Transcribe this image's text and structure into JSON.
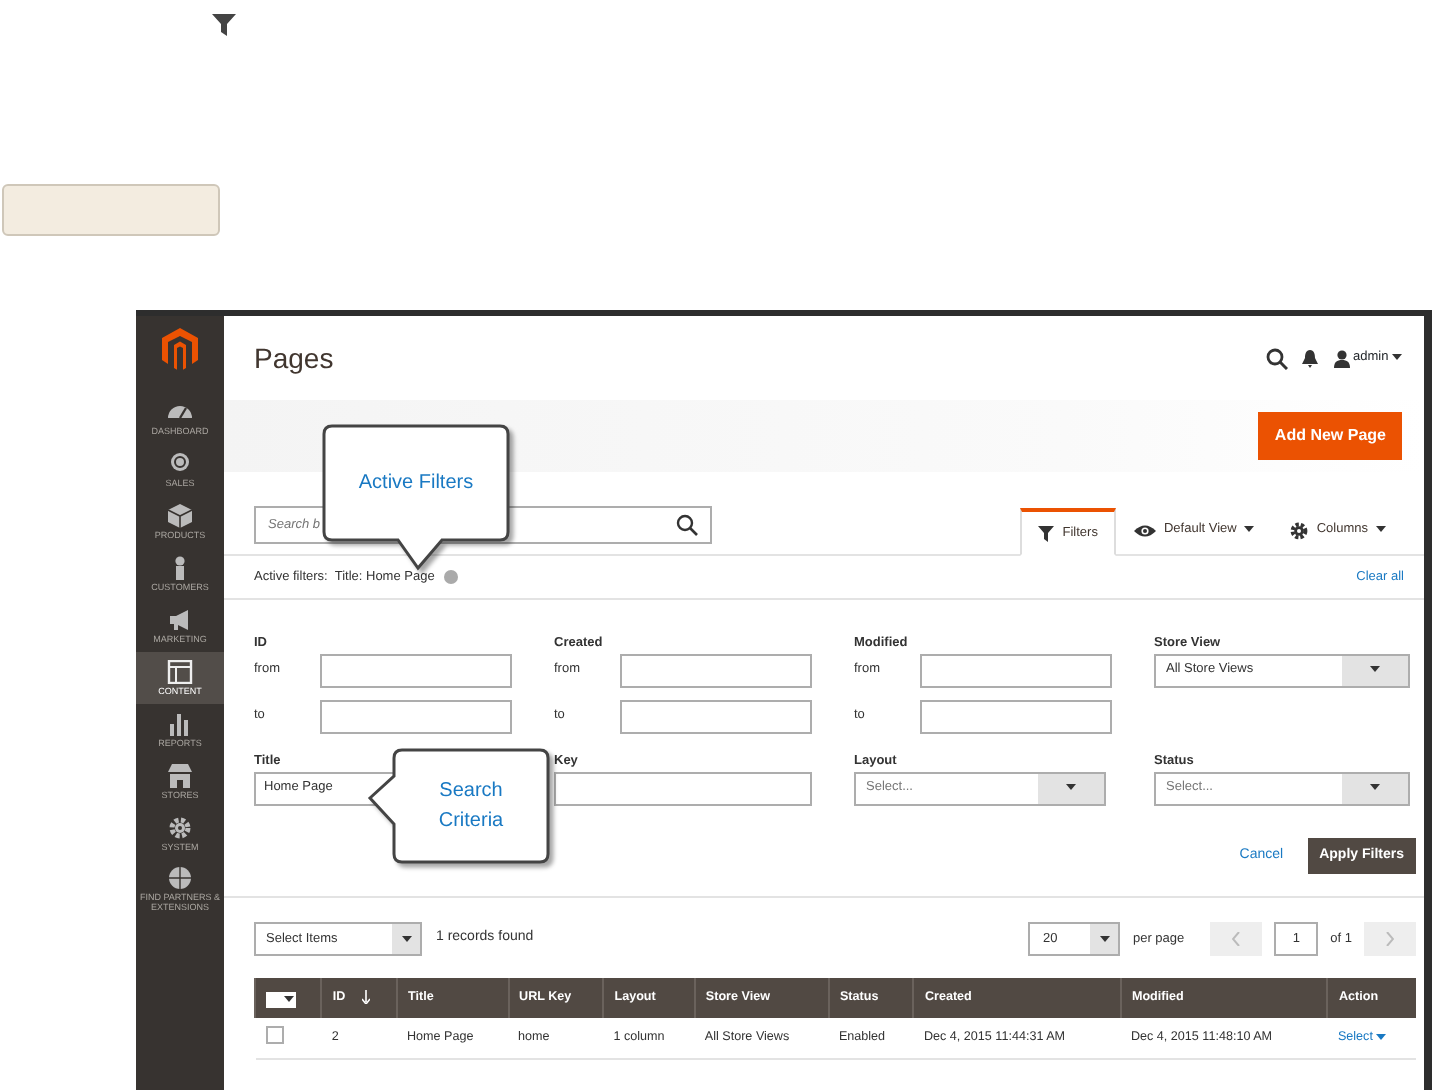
{
  "sidebar": {
    "items": [
      {
        "label": "DASHBOARD",
        "selected": false
      },
      {
        "label": "SALES",
        "selected": false
      },
      {
        "label": "PRODUCTS",
        "selected": false
      },
      {
        "label": "CUSTOMERS",
        "selected": false
      },
      {
        "label": "MARKETING",
        "selected": false
      },
      {
        "label": "CONTENT",
        "selected": true
      },
      {
        "label": "REPORTS",
        "selected": false
      },
      {
        "label": "STORES",
        "selected": false
      },
      {
        "label": "SYSTEM",
        "selected": false
      },
      {
        "label": "FIND PARTNERS & EXTENSIONS",
        "selected": false
      }
    ]
  },
  "header": {
    "title": "Pages",
    "user": "admin"
  },
  "add_button": "Add New Page",
  "search": {
    "placeholder": "Search b"
  },
  "view_tabs": [
    {
      "kind": "filter",
      "label": "Filters",
      "selected": true
    },
    {
      "kind": "view",
      "label": "Default View",
      "selected": false
    },
    {
      "kind": "columns",
      "label": "Columns",
      "selected": false
    }
  ],
  "active_filters": {
    "label": "Active filters:",
    "chips": [
      "Title: Home Page"
    ],
    "clear": "Clear all"
  },
  "filters": [
    {
      "kind": "range",
      "label": "ID",
      "from_label": "from",
      "to_label": "to"
    },
    {
      "kind": "range",
      "label": "Created",
      "from_label": "from",
      "to_label": "to"
    },
    {
      "kind": "range",
      "label": "Modified",
      "from_label": "from",
      "to_label": "to"
    },
    {
      "kind": "select",
      "label": "Store View",
      "value": "All Store Views"
    },
    {
      "kind": "text",
      "label": "Title",
      "value": "Home Page"
    },
    {
      "kind": "text",
      "label": "Key"
    },
    {
      "kind": "select",
      "label": "Layout",
      "placeholder": "Select..."
    },
    {
      "kind": "select",
      "label": "Status",
      "placeholder": "Select..."
    }
  ],
  "filter_actions": {
    "cancel": "Cancel",
    "apply": "Apply Filters"
  },
  "mass_action": "Select Items",
  "records": "1 records found",
  "pagination": {
    "per_page": "20",
    "per_page_label": "per page",
    "page": "1",
    "of": "of 1"
  },
  "table": {
    "select_all": {
      "checked": false
    },
    "columns": [
      "ID",
      "Title",
      "URL Key",
      "Layout",
      "Store View",
      "Status",
      "Created",
      "Modified",
      "Action"
    ],
    "rows": [
      {
        "checked": false,
        "cells": [
          "2",
          "Home Page",
          "home",
          "1 column",
          "All Store Views",
          "Enabled",
          "Dec 4, 2015 11:44:31 AM",
          "Dec 4, 2015 11:48:10 AM"
        ],
        "action": "Select"
      }
    ]
  },
  "callouts": [
    {
      "kind": "down",
      "text": "Active Filters"
    },
    {
      "kind": "left",
      "text": "Search Criteria"
    }
  ]
}
